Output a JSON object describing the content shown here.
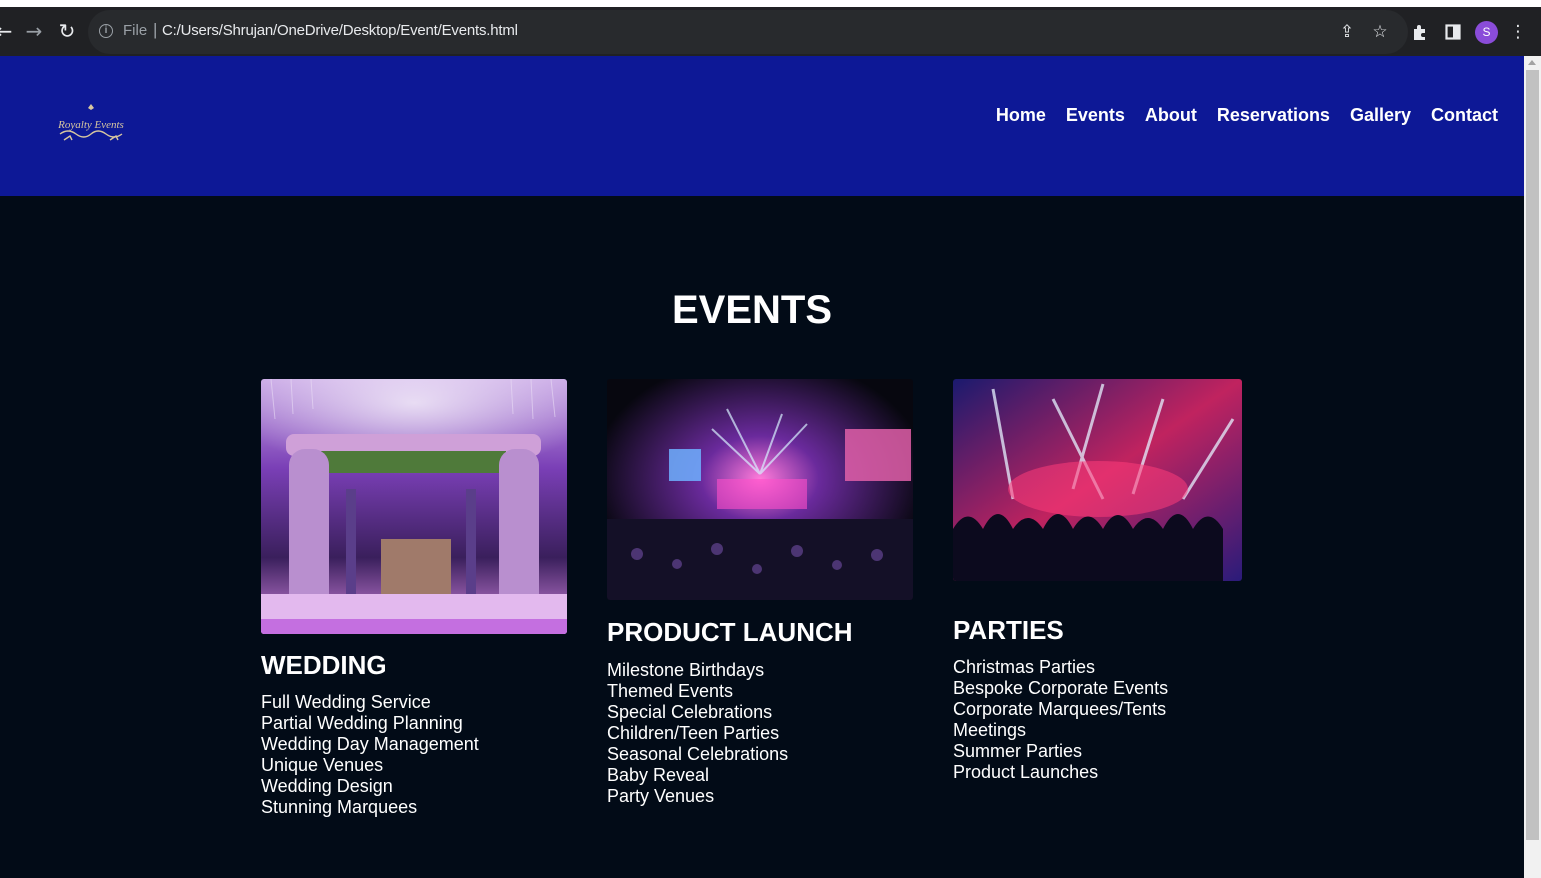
{
  "browser": {
    "file_label": "File",
    "url": "C:/Users/Shrujan/OneDrive/Desktop/Event/Events.html",
    "profile_initial": "S",
    "icons": [
      "back-icon",
      "forward-icon",
      "reload-icon",
      "info-icon",
      "share-icon",
      "star-icon",
      "extensions-icon",
      "side-panel-icon",
      "menu-icon"
    ]
  },
  "site": {
    "logo_text": "Royalty Events",
    "nav": [
      "Home",
      "Events",
      "About",
      "Reservations",
      "Gallery",
      "Contact"
    ],
    "colors": {
      "header": "#0d1896",
      "background": "#020b17",
      "text": "#ffffff"
    }
  },
  "main": {
    "title": "EVENTS",
    "cards": [
      {
        "title": "WEDDING",
        "items": [
          "Full Wedding Service",
          "Partial Wedding Planning",
          "Wedding Day Management",
          "Unique Venues",
          "Wedding Design",
          "Stunning Marquees"
        ]
      },
      {
        "title": "PRODUCT LAUNCH",
        "items": [
          "Milestone Birthdays",
          "Themed Events",
          "Special Celebrations",
          "Children/Teen Parties",
          "Seasonal Celebrations",
          "Baby Reveal",
          "Party Venues"
        ]
      },
      {
        "title": "PARTIES",
        "items": [
          "Christmas Parties",
          "Bespoke Corporate Events",
          "Corporate Marquees/Tents",
          "Meetings",
          "Summer Parties",
          "Product Launches"
        ]
      }
    ]
  }
}
